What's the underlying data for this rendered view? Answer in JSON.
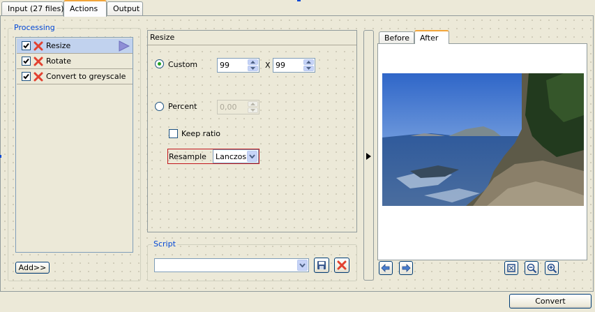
{
  "tabs": [
    {
      "label": "Input (27 files)"
    },
    {
      "label": "Actions"
    },
    {
      "label": "Output"
    }
  ],
  "processing": {
    "title": "Processing",
    "items": [
      {
        "label": "Resize",
        "checked": true
      },
      {
        "label": "Rotate",
        "checked": true
      },
      {
        "label": "Convert to greyscale",
        "checked": true
      }
    ],
    "add_button": "Add>>"
  },
  "resize": {
    "header": "Resize",
    "custom_label": "Custom",
    "width_value": "99",
    "x_separator": "X",
    "height_value": "99",
    "percent_label": "Percent",
    "percent_value": "0,00",
    "keep_ratio_label": "Keep ratio",
    "resample_label": "Resample",
    "resample_value": "Lanczos"
  },
  "script": {
    "title": "Script",
    "value": ""
  },
  "preview": {
    "tabs": [
      {
        "label": "Before"
      },
      {
        "label": "After"
      }
    ]
  },
  "convert_button": "Convert",
  "colors": {
    "accent": "#0046d5",
    "tab_highlight": "#f2a53a",
    "resample_border": "#c2151b"
  }
}
